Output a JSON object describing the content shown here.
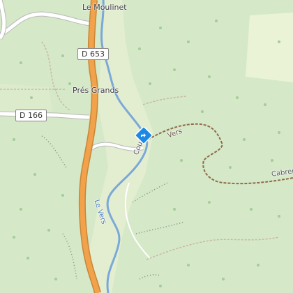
{
  "map": {
    "places": {
      "moulinet": "Le Moulinet",
      "pres_grands": "Prés Grands",
      "cabrer": "Cabrere"
    },
    "roads": {
      "d653": "D 653",
      "d166": "D 166"
    },
    "waterways": {
      "le_vers": "Le Vers",
      "cours": "Cours",
      "vers": "Vers"
    },
    "colors": {
      "forest": "#d5e8c8",
      "meadow": "#e5efcf",
      "light_field": "#eaf3d5",
      "valley": "#dfecc9",
      "main_road": "#f1a24a",
      "road_casing": "#c7873a",
      "minor_road": "#ffffff",
      "river": "#7aa9d9",
      "trail": "#9a7a5c",
      "cliff": "#7a8a7a",
      "marker": "#1e88e5"
    },
    "marker_icon": "directions-sign-icon"
  }
}
